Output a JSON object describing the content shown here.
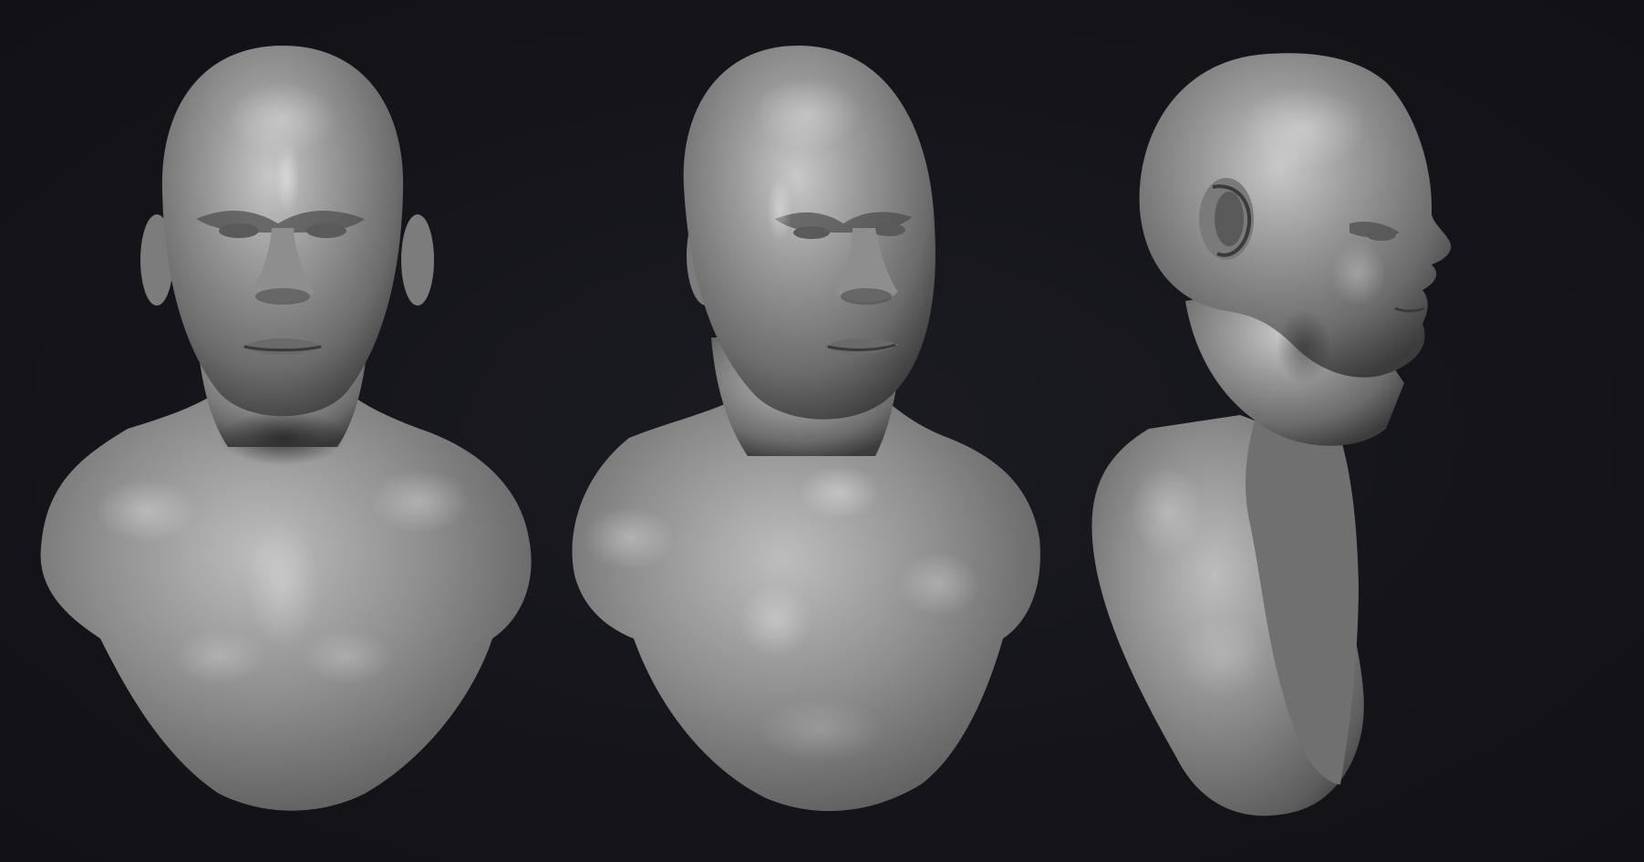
{
  "scene": {
    "background_color": "#14141a",
    "material_color": "#8f8f8f",
    "views": [
      {
        "id": "front",
        "name": "front-view"
      },
      {
        "id": "three-quarter",
        "name": "three-quarter-view"
      },
      {
        "id": "side",
        "name": "side-profile-view"
      }
    ]
  }
}
